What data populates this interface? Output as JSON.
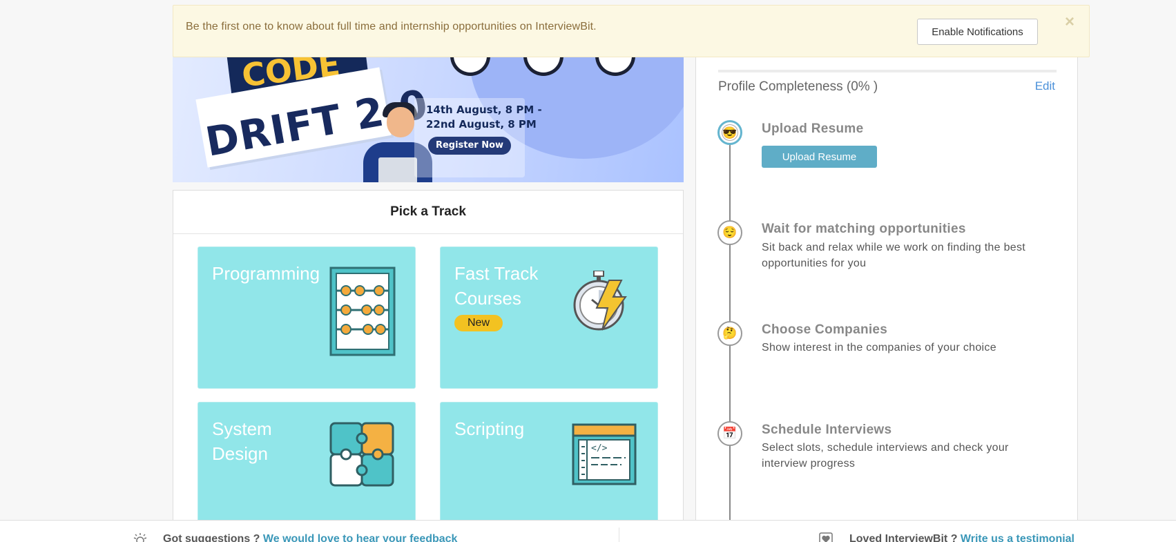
{
  "notification": {
    "text": "Be the first one to know about full time and internship opportunities on InterviewBit.",
    "button_label": "Enable Notifications",
    "close_glyph": "×"
  },
  "banner": {
    "code_text": "CODE",
    "title_text": "DRIFT 2.0",
    "date_line_1": "14th August, 8 PM -",
    "date_line_2": "22nd August, 8 PM",
    "register_label": "Register Now"
  },
  "tracks": {
    "heading": "Pick a Track",
    "items": [
      {
        "title": "Programming",
        "icon": "abacus-icon"
      },
      {
        "title": "Fast Track Courses",
        "icon": "stopwatch-lightning-icon",
        "badge": "New"
      },
      {
        "title": "System Design",
        "icon": "puzzle-icon"
      },
      {
        "title": "Scripting",
        "icon": "code-window-icon"
      }
    ]
  },
  "profile": {
    "title": "Profile Completeness (0% )",
    "edit_label": "Edit",
    "steps": [
      {
        "title": "Upload Resume",
        "button": "Upload Resume",
        "emoji": "😎"
      },
      {
        "title": "Wait for matching opportunities",
        "desc": "Sit back and relax while we work on finding the best opportunities for you",
        "emoji": "😌"
      },
      {
        "title": "Choose Companies",
        "desc": "Show interest in the companies of your choice",
        "emoji": "🤔"
      },
      {
        "title": "Schedule Interviews",
        "desc": "Select slots, schedule interviews and check your interview progress",
        "emoji": "📅"
      }
    ]
  },
  "footer": {
    "suggest_prefix": "Got suggestions ?",
    "suggest_link": "We would love to hear your feedback",
    "loved_prefix": "Loved InterviewBit ?",
    "loved_link": "Write us a testimonial"
  },
  "colors": {
    "tile_bg": "#91e6e9",
    "accent_blue": "#5fadc7",
    "badge_yellow": "#f3c221",
    "notification_bg": "#fcf8e3"
  }
}
